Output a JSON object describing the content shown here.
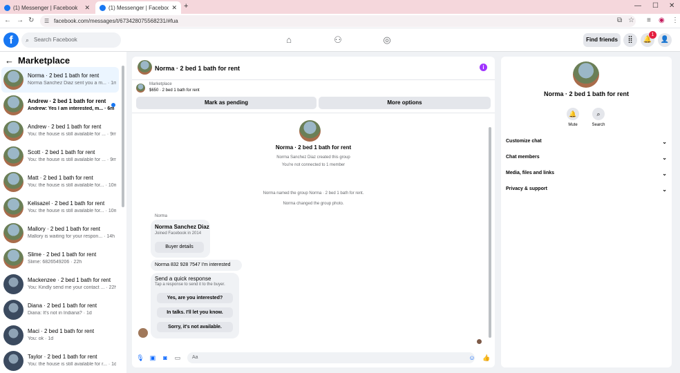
{
  "browser": {
    "tabs": [
      {
        "label": "(1) Messenger | Facebook"
      },
      {
        "label": "(1) Messenger | Facebook"
      }
    ],
    "url": "facebook.com/messages/t/6734280755682​31/#fua"
  },
  "header": {
    "search_placeholder": "Search Facebook",
    "find_friends": "Find friends",
    "notif_count": "1"
  },
  "sidebar": {
    "title": "Marketplace",
    "conversations": [
      {
        "name": "Norma · 2 bed 1 bath for rent",
        "preview": "Norma Sanchez Diaz sent you a m... · 1m",
        "selected": true
      },
      {
        "name": "Andrew · 2 bed 1 bath for rent",
        "preview": "Andrew: Yes I am interested, m... · 6m",
        "unread": true
      },
      {
        "name": "Andrew · 2 bed 1 bath for rent",
        "preview": "You: the house is still available for ... · 9m"
      },
      {
        "name": "Scott · 2 bed 1 bath for rent",
        "preview": "You: the house is still available for ... · 9m"
      },
      {
        "name": "Matt · 2 bed 1 bath for rent",
        "preview": "You: the house is still available for... · 10m"
      },
      {
        "name": "Kelisazel · 2 bed 1 bath for rent",
        "preview": "You: the house is still available for... · 10m"
      },
      {
        "name": "Mallory · 2 bed 1 bath for rent",
        "preview": "Mallory is waiting for your respon... · 14h"
      },
      {
        "name": "Slime · 2 bed 1 bath for rent",
        "preview": "Slime: 6826549206 · 22h"
      },
      {
        "name": "Mackenzee · 2 bed 1 bath for rent",
        "preview": "You: Kindly send me your contact ... · 22h"
      },
      {
        "name": "Diana · 2 bed 1 bath for rent",
        "preview": "Diana: It's not in Indiana? · 1d"
      },
      {
        "name": "Maci · 2 bed 1 bath for rent",
        "preview": "You: ok · 1d"
      },
      {
        "name": "Taylor · 2 bed 1 bath for rent",
        "preview": "You: the house is still available for r... · 1d"
      }
    ]
  },
  "chat": {
    "title": "Norma · 2 bed 1 bath for rent",
    "marketplace_label": "Marketplace",
    "listing": "$650 · 2 bed 1 bath for rent",
    "mark_pending": "Mark as pending",
    "more_options": "More options",
    "group_name": "Norma · 2 bed 1 bath for rent",
    "created": "Norma Sanchez Diaz created this group",
    "not_connected": "You're not connected to 1 member",
    "named_event": "Norma named the group Norma · 2 bed 1 bath for rent.",
    "photo_event": "Norma changed the group photo.",
    "sender": "Norma",
    "card_name": "Norma Sanchez Diaz",
    "card_joined": "Joined Facebook in 2014",
    "buyer_details": "Buyer details",
    "message": "Norma 832 928 7547 I'm interested",
    "quick_title": "Send a quick response",
    "quick_sub": "Tap a response to send it to the buyer.",
    "options": [
      "Yes, are you interested?",
      "In talks. I'll let you know.",
      "Sorry, it's not available."
    ],
    "composer_placeholder": "Aa"
  },
  "panel": {
    "name": "Norma · 2 bed 1 bath for rent",
    "mute": "Mute",
    "search": "Search",
    "items": [
      "Customize chat",
      "Chat members",
      "Media, files and links",
      "Privacy & support"
    ]
  }
}
